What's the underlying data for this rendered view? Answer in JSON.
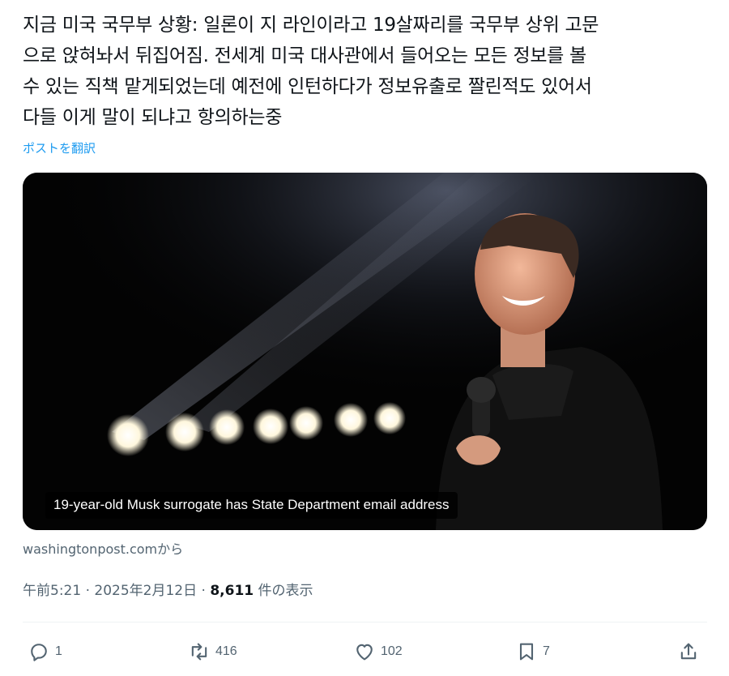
{
  "tweet": {
    "lines": [
      "지금 미국 국무부 상황: 일론이 지 라인이라고 19살짜리를 국무부 상위 고문",
      "으로 앉혀놔서 뒤집어짐. 전세계 미국 대사관에서 들어오는 모든 정보를 볼",
      "수 있는 직책 맡게되었는데 예전에 인턴하다가 정보유출로 짤린적도 있어서",
      "다들 이게 말이 되냐고 항의하는중"
    ],
    "translate_label": "ポストを翻訳"
  },
  "media": {
    "caption": "19-year-old Musk surrogate has State Department email address"
  },
  "source": {
    "domain": "washingtonpost.com",
    "suffix": "から"
  },
  "meta": {
    "time": "午前5:21",
    "date": "2025年2月12日",
    "views": "8,611",
    "views_suffix": "件の表示",
    "separator": "·"
  },
  "actions": {
    "reply": {
      "icon": "reply-icon",
      "count": "1"
    },
    "repost": {
      "icon": "repost-icon",
      "count": "416"
    },
    "like": {
      "icon": "heart-icon",
      "count": "102"
    },
    "bookmark": {
      "icon": "bookmark-icon",
      "count": "7"
    },
    "share": {
      "icon": "share-icon"
    }
  },
  "colors": {
    "text": "#0f1419",
    "secondary": "#536471",
    "link": "#1d9bf0"
  }
}
